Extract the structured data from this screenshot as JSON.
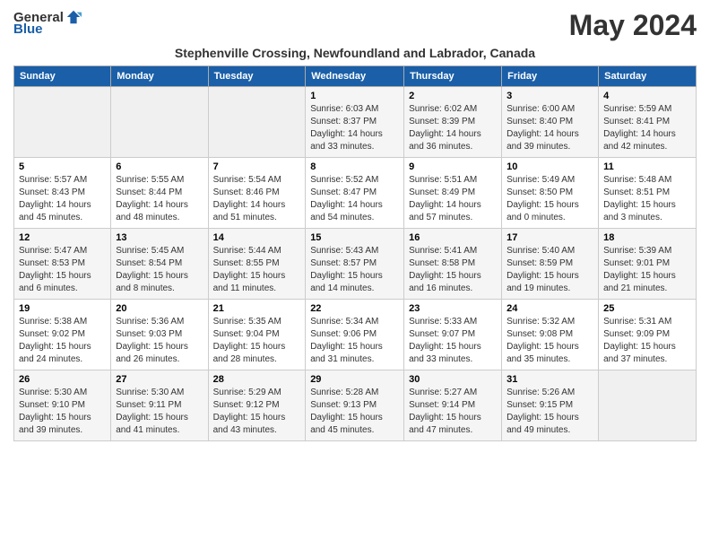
{
  "header": {
    "logo_general": "General",
    "logo_blue": "Blue",
    "month_title": "May 2024",
    "subtitle": "Stephenville Crossing, Newfoundland and Labrador, Canada"
  },
  "days_of_week": [
    "Sunday",
    "Monday",
    "Tuesday",
    "Wednesday",
    "Thursday",
    "Friday",
    "Saturday"
  ],
  "weeks": [
    [
      {
        "day": "",
        "info": ""
      },
      {
        "day": "",
        "info": ""
      },
      {
        "day": "",
        "info": ""
      },
      {
        "day": "1",
        "info": "Sunrise: 6:03 AM\nSunset: 8:37 PM\nDaylight: 14 hours\nand 33 minutes."
      },
      {
        "day": "2",
        "info": "Sunrise: 6:02 AM\nSunset: 8:39 PM\nDaylight: 14 hours\nand 36 minutes."
      },
      {
        "day": "3",
        "info": "Sunrise: 6:00 AM\nSunset: 8:40 PM\nDaylight: 14 hours\nand 39 minutes."
      },
      {
        "day": "4",
        "info": "Sunrise: 5:59 AM\nSunset: 8:41 PM\nDaylight: 14 hours\nand 42 minutes."
      }
    ],
    [
      {
        "day": "5",
        "info": "Sunrise: 5:57 AM\nSunset: 8:43 PM\nDaylight: 14 hours\nand 45 minutes."
      },
      {
        "day": "6",
        "info": "Sunrise: 5:55 AM\nSunset: 8:44 PM\nDaylight: 14 hours\nand 48 minutes."
      },
      {
        "day": "7",
        "info": "Sunrise: 5:54 AM\nSunset: 8:46 PM\nDaylight: 14 hours\nand 51 minutes."
      },
      {
        "day": "8",
        "info": "Sunrise: 5:52 AM\nSunset: 8:47 PM\nDaylight: 14 hours\nand 54 minutes."
      },
      {
        "day": "9",
        "info": "Sunrise: 5:51 AM\nSunset: 8:49 PM\nDaylight: 14 hours\nand 57 minutes."
      },
      {
        "day": "10",
        "info": "Sunrise: 5:49 AM\nSunset: 8:50 PM\nDaylight: 15 hours\nand 0 minutes."
      },
      {
        "day": "11",
        "info": "Sunrise: 5:48 AM\nSunset: 8:51 PM\nDaylight: 15 hours\nand 3 minutes."
      }
    ],
    [
      {
        "day": "12",
        "info": "Sunrise: 5:47 AM\nSunset: 8:53 PM\nDaylight: 15 hours\nand 6 minutes."
      },
      {
        "day": "13",
        "info": "Sunrise: 5:45 AM\nSunset: 8:54 PM\nDaylight: 15 hours\nand 8 minutes."
      },
      {
        "day": "14",
        "info": "Sunrise: 5:44 AM\nSunset: 8:55 PM\nDaylight: 15 hours\nand 11 minutes."
      },
      {
        "day": "15",
        "info": "Sunrise: 5:43 AM\nSunset: 8:57 PM\nDaylight: 15 hours\nand 14 minutes."
      },
      {
        "day": "16",
        "info": "Sunrise: 5:41 AM\nSunset: 8:58 PM\nDaylight: 15 hours\nand 16 minutes."
      },
      {
        "day": "17",
        "info": "Sunrise: 5:40 AM\nSunset: 8:59 PM\nDaylight: 15 hours\nand 19 minutes."
      },
      {
        "day": "18",
        "info": "Sunrise: 5:39 AM\nSunset: 9:01 PM\nDaylight: 15 hours\nand 21 minutes."
      }
    ],
    [
      {
        "day": "19",
        "info": "Sunrise: 5:38 AM\nSunset: 9:02 PM\nDaylight: 15 hours\nand 24 minutes."
      },
      {
        "day": "20",
        "info": "Sunrise: 5:36 AM\nSunset: 9:03 PM\nDaylight: 15 hours\nand 26 minutes."
      },
      {
        "day": "21",
        "info": "Sunrise: 5:35 AM\nSunset: 9:04 PM\nDaylight: 15 hours\nand 28 minutes."
      },
      {
        "day": "22",
        "info": "Sunrise: 5:34 AM\nSunset: 9:06 PM\nDaylight: 15 hours\nand 31 minutes."
      },
      {
        "day": "23",
        "info": "Sunrise: 5:33 AM\nSunset: 9:07 PM\nDaylight: 15 hours\nand 33 minutes."
      },
      {
        "day": "24",
        "info": "Sunrise: 5:32 AM\nSunset: 9:08 PM\nDaylight: 15 hours\nand 35 minutes."
      },
      {
        "day": "25",
        "info": "Sunrise: 5:31 AM\nSunset: 9:09 PM\nDaylight: 15 hours\nand 37 minutes."
      }
    ],
    [
      {
        "day": "26",
        "info": "Sunrise: 5:30 AM\nSunset: 9:10 PM\nDaylight: 15 hours\nand 39 minutes."
      },
      {
        "day": "27",
        "info": "Sunrise: 5:30 AM\nSunset: 9:11 PM\nDaylight: 15 hours\nand 41 minutes."
      },
      {
        "day": "28",
        "info": "Sunrise: 5:29 AM\nSunset: 9:12 PM\nDaylight: 15 hours\nand 43 minutes."
      },
      {
        "day": "29",
        "info": "Sunrise: 5:28 AM\nSunset: 9:13 PM\nDaylight: 15 hours\nand 45 minutes."
      },
      {
        "day": "30",
        "info": "Sunrise: 5:27 AM\nSunset: 9:14 PM\nDaylight: 15 hours\nand 47 minutes."
      },
      {
        "day": "31",
        "info": "Sunrise: 5:26 AM\nSunset: 9:15 PM\nDaylight: 15 hours\nand 49 minutes."
      },
      {
        "day": "",
        "info": ""
      }
    ]
  ]
}
